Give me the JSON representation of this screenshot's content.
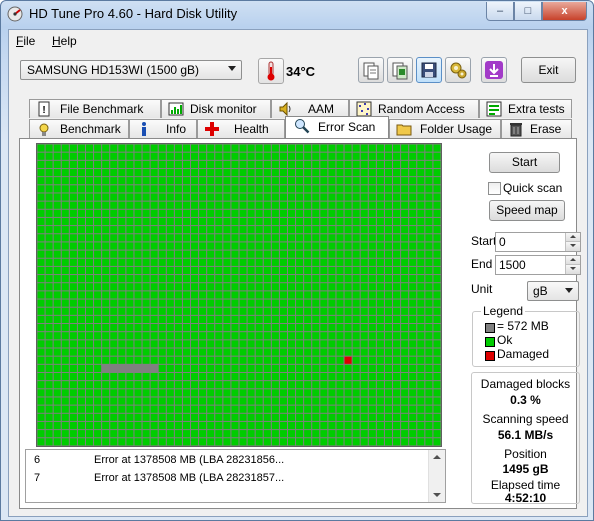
{
  "window": {
    "title": "HD Tune Pro 4.60 - Hard Disk Utility",
    "close_glyph": "x",
    "min_glyph": "–",
    "max_glyph": "□"
  },
  "menu": [
    {
      "label": "File",
      "underline": "F",
      "rest": "ile"
    },
    {
      "label": "Help",
      "underline": "H",
      "rest": "elp"
    }
  ],
  "toolbar": {
    "drive": "SAMSUNG HD153WI (1500 gB)",
    "temperature": "34°C",
    "buttons": [
      "copy-info-icon",
      "copy-screenshot-icon",
      "save-icon",
      "options-icon",
      "download-icon"
    ],
    "exit_label": "Exit"
  },
  "tabs_row1": [
    {
      "label": "File Benchmark",
      "icon": "file-benchmark-icon"
    },
    {
      "label": "Disk monitor",
      "icon": "disk-monitor-icon"
    },
    {
      "label": "AAM",
      "icon": "speaker-icon"
    },
    {
      "label": "Random Access",
      "icon": "random-access-icon"
    },
    {
      "label": "Extra tests",
      "icon": "extra-tests-icon"
    }
  ],
  "tabs_row2": [
    {
      "label": "Benchmark",
      "icon": "benchmark-icon"
    },
    {
      "label": "Info",
      "icon": "info-icon"
    },
    {
      "label": "Health",
      "icon": "health-cross-icon"
    },
    {
      "label": "Error Scan",
      "icon": "magnifier-icon",
      "active": true
    },
    {
      "label": "Folder Usage",
      "icon": "folder-icon"
    },
    {
      "label": "Erase",
      "icon": "trash-icon"
    }
  ],
  "scan_map": {
    "colors": {
      "ok": "#00cc00",
      "damaged": "#dd0000",
      "unscanned": "#808080"
    },
    "damaged_blocks": [
      1338
    ],
    "unscanned_blocks": [
      1358,
      1359,
      1360,
      1361,
      1362,
      1363,
      1364
    ]
  },
  "log": {
    "rows": [
      {
        "num": "6",
        "message": "Error at 1378508 MB (LBA 28231856..."
      },
      {
        "num": "7",
        "message": "Error at 1378508 MB (LBA 28231857..."
      }
    ]
  },
  "controls": {
    "start_label": "Start",
    "quick_scan_label": "Quick scan",
    "quick_scan_checked": false,
    "speed_map_label": "Speed map",
    "start_field_label": "Start",
    "start_value": "0",
    "end_field_label": "End",
    "end_value": "1500",
    "unit_label": "Unit",
    "unit_value": "gB"
  },
  "legend": {
    "title": "Legend",
    "items": [
      {
        "text": "= 572 MB",
        "color": "#808080"
      },
      {
        "text": "Ok",
        "color": "#00cc00"
      },
      {
        "text": "Damaged",
        "color": "#dd0000"
      }
    ]
  },
  "stats": {
    "damaged_label": "Damaged blocks",
    "damaged_value": "0.3 %",
    "speed_label": "Scanning speed",
    "speed_value": "56.1 MB/s",
    "position_label": "Position",
    "position_value": "1495 gB",
    "elapsed_label": "Elapsed time",
    "elapsed_value": "4:52:10"
  }
}
